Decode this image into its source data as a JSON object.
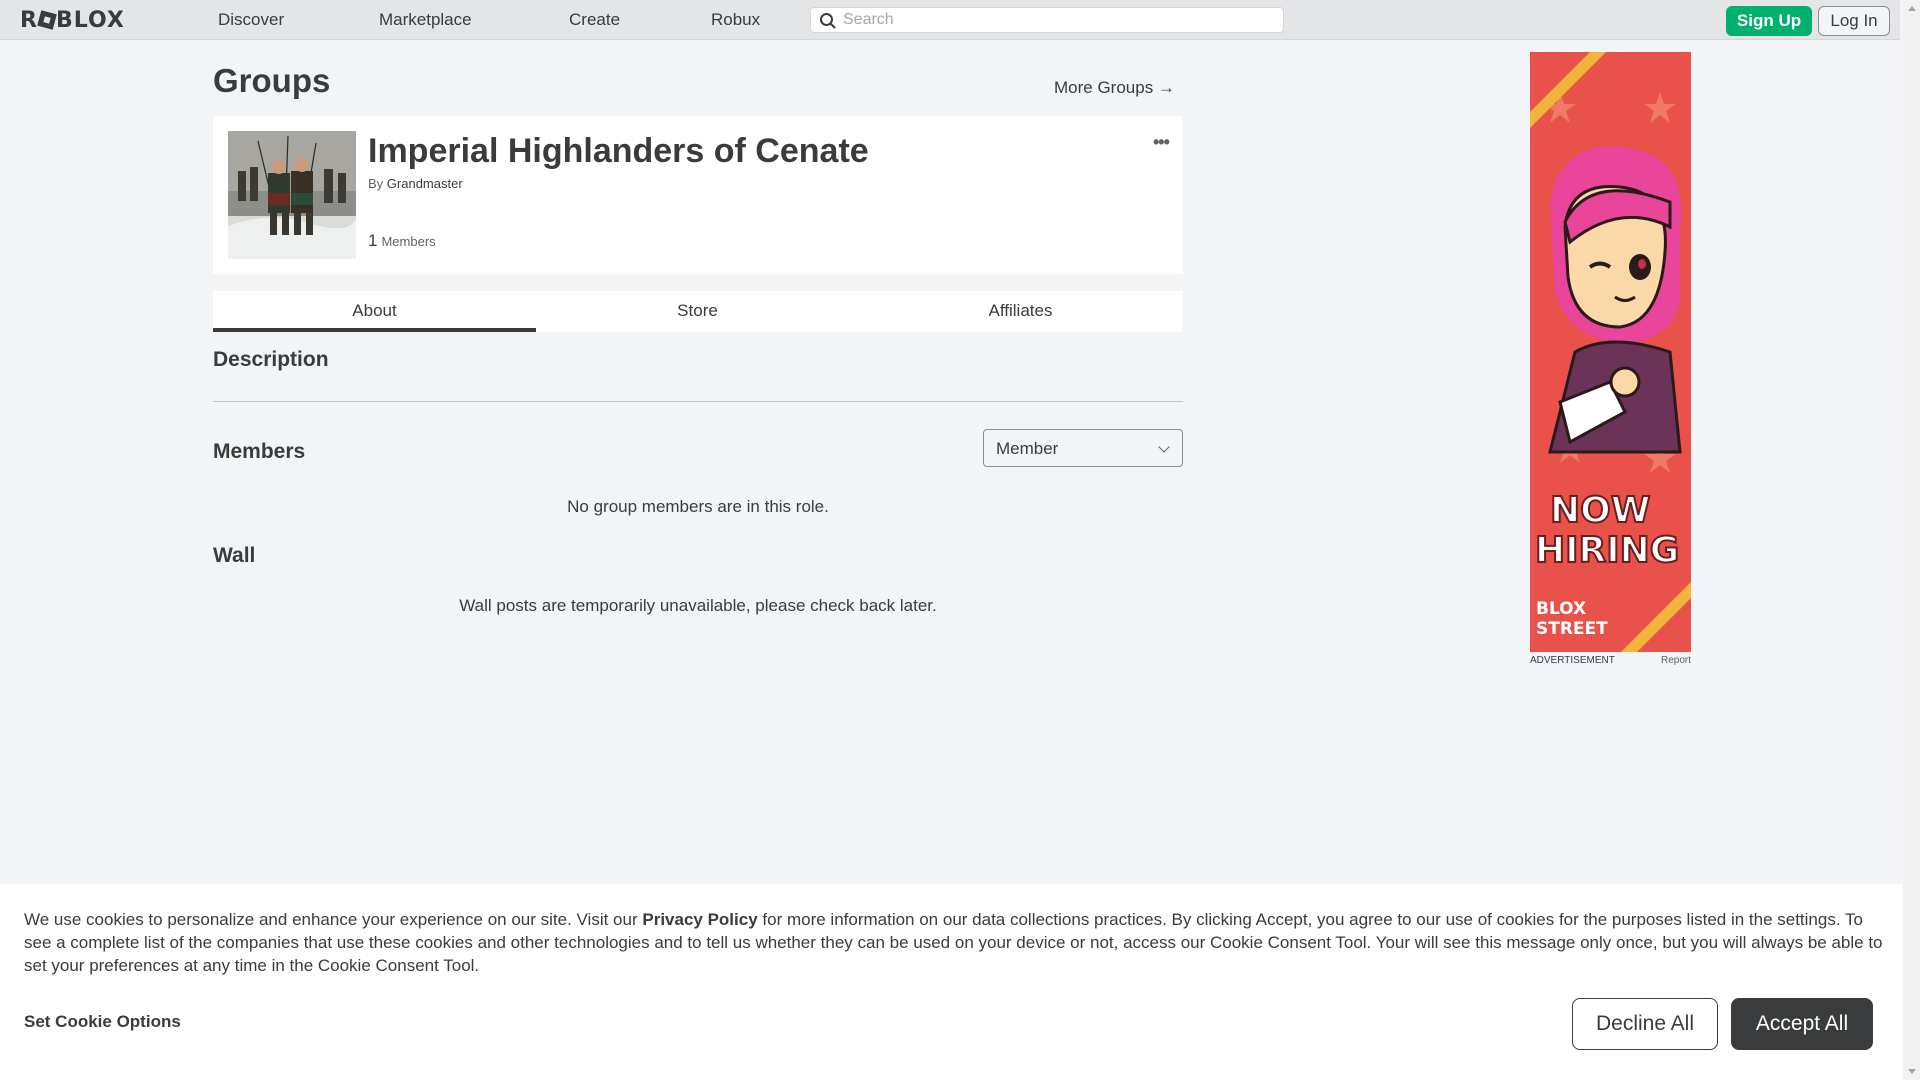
{
  "nav": {
    "logo": "ROBLOX",
    "links": [
      "Discover",
      "Marketplace",
      "Create",
      "Robux"
    ],
    "search_placeholder": "Search",
    "signup_label": "Sign Up",
    "login_label": "Log In"
  },
  "page": {
    "title": "Groups",
    "more_groups": "More Groups →"
  },
  "group": {
    "name": "Imperial Highlanders of Cenate",
    "owner_prefix": "By",
    "owner": "Grandmaster",
    "member_count": "1",
    "members_label": "Members",
    "more_icon": "more-dots-icon"
  },
  "tabs": [
    "About",
    "Store",
    "Affiliates"
  ],
  "about": {
    "description_heading": "Description",
    "members_heading": "Members",
    "role_selected": "Member",
    "members_empty": "No group members are in this role.",
    "wall_heading": "Wall",
    "wall_message": "Wall posts are temporarily unavailable, please check back later."
  },
  "ad": {
    "headline_1": "NOW",
    "headline_2": "HIRING",
    "brand_1": "BLOX",
    "brand_2": "STREET",
    "caption": "ADVERTISEMENT",
    "report": "Report",
    "colors": {
      "bg": "#e8524a",
      "stripe": "#f3b43c",
      "hair": "#e9459a"
    }
  },
  "cookie": {
    "text_before": "We use cookies to personalize and enhance your experience on our site. Visit our ",
    "link": "Privacy Policy",
    "text_after": " for more information on our data collections practices. By clicking Accept, you agree to our use of cookies for the purposes listed in the settings. To see a complete list of the companies that use these cookies and other technologies and to tell us whether they can be used on your device or not, access our Cookie Consent Tool. Your will see this message only once, but you will always be able to set your preferences at any time in the Cookie Consent Tool.",
    "options_label": "Set Cookie Options",
    "decline_label": "Decline All",
    "accept_label": "Accept All"
  },
  "colors": {
    "accent_green": "#00b06f",
    "text": "#393b3d",
    "page_bg": "#f2f4f5"
  }
}
